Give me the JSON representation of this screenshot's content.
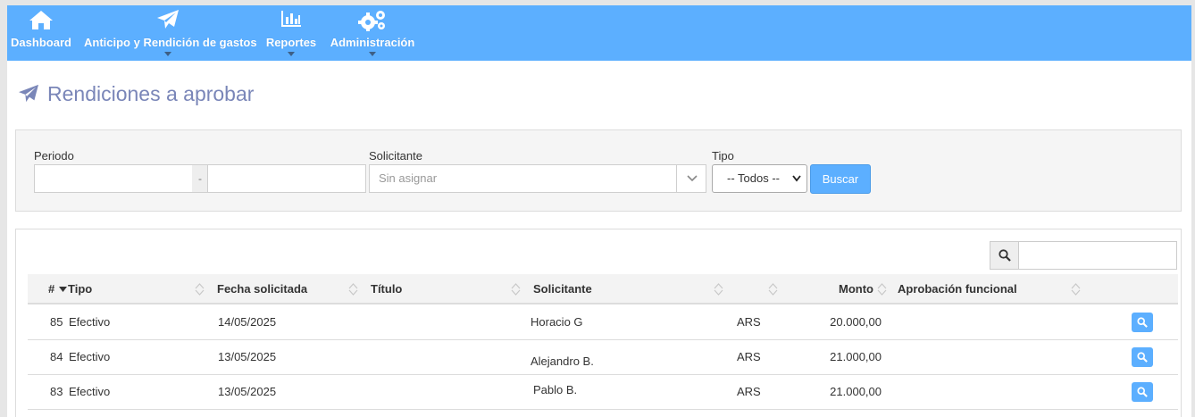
{
  "nav": {
    "items": [
      {
        "label": "Dashboard",
        "icon": "home-icon",
        "has_dropdown": false
      },
      {
        "label": "Anticipo y Rendición de gastos",
        "icon": "paper-plane-icon",
        "has_dropdown": true
      },
      {
        "label": "Reportes",
        "icon": "bar-chart-icon",
        "has_dropdown": true
      },
      {
        "label": "Administración",
        "icon": "gears-icon",
        "has_dropdown": true
      }
    ]
  },
  "page": {
    "title": "Rendiciones a aprobar",
    "title_icon": "paper-plane-icon"
  },
  "filters": {
    "periodo_label": "Periodo",
    "periodo_from": "",
    "periodo_sep": "-",
    "periodo_to": "",
    "solicitante_label": "Solicitante",
    "solicitante_placeholder": "Sin asignar",
    "tipo_label": "Tipo",
    "tipo_value": "-- Todos --",
    "search_button": "Buscar"
  },
  "table": {
    "search_value": "",
    "columns": [
      "#",
      "Tipo",
      "Fecha solicitada",
      "Título",
      "Solicitante",
      "",
      "Monto",
      "Aprobación funcional"
    ],
    "rows": [
      {
        "id": "85",
        "tipo": "Efectivo",
        "fecha": "14/05/2025",
        "titulo": "",
        "solicitante": "Horacio G",
        "moneda": "ARS",
        "monto": "20.000,00",
        "aprobacion": ""
      },
      {
        "id": "84",
        "tipo": "Efectivo",
        "fecha": "13/05/2025",
        "titulo": "",
        "solicitante": "Alejandro B.",
        "moneda": "ARS",
        "monto": "21.000,00",
        "aprobacion": ""
      },
      {
        "id": "83",
        "tipo": "Efectivo",
        "fecha": "13/05/2025",
        "titulo": "",
        "solicitante": "Pablo B.",
        "moneda": "ARS",
        "monto": "21.000,00",
        "aprobacion": ""
      }
    ]
  },
  "colors": {
    "navbar": "#5cafff",
    "title": "#7a86b8",
    "button": "#5cafff"
  }
}
